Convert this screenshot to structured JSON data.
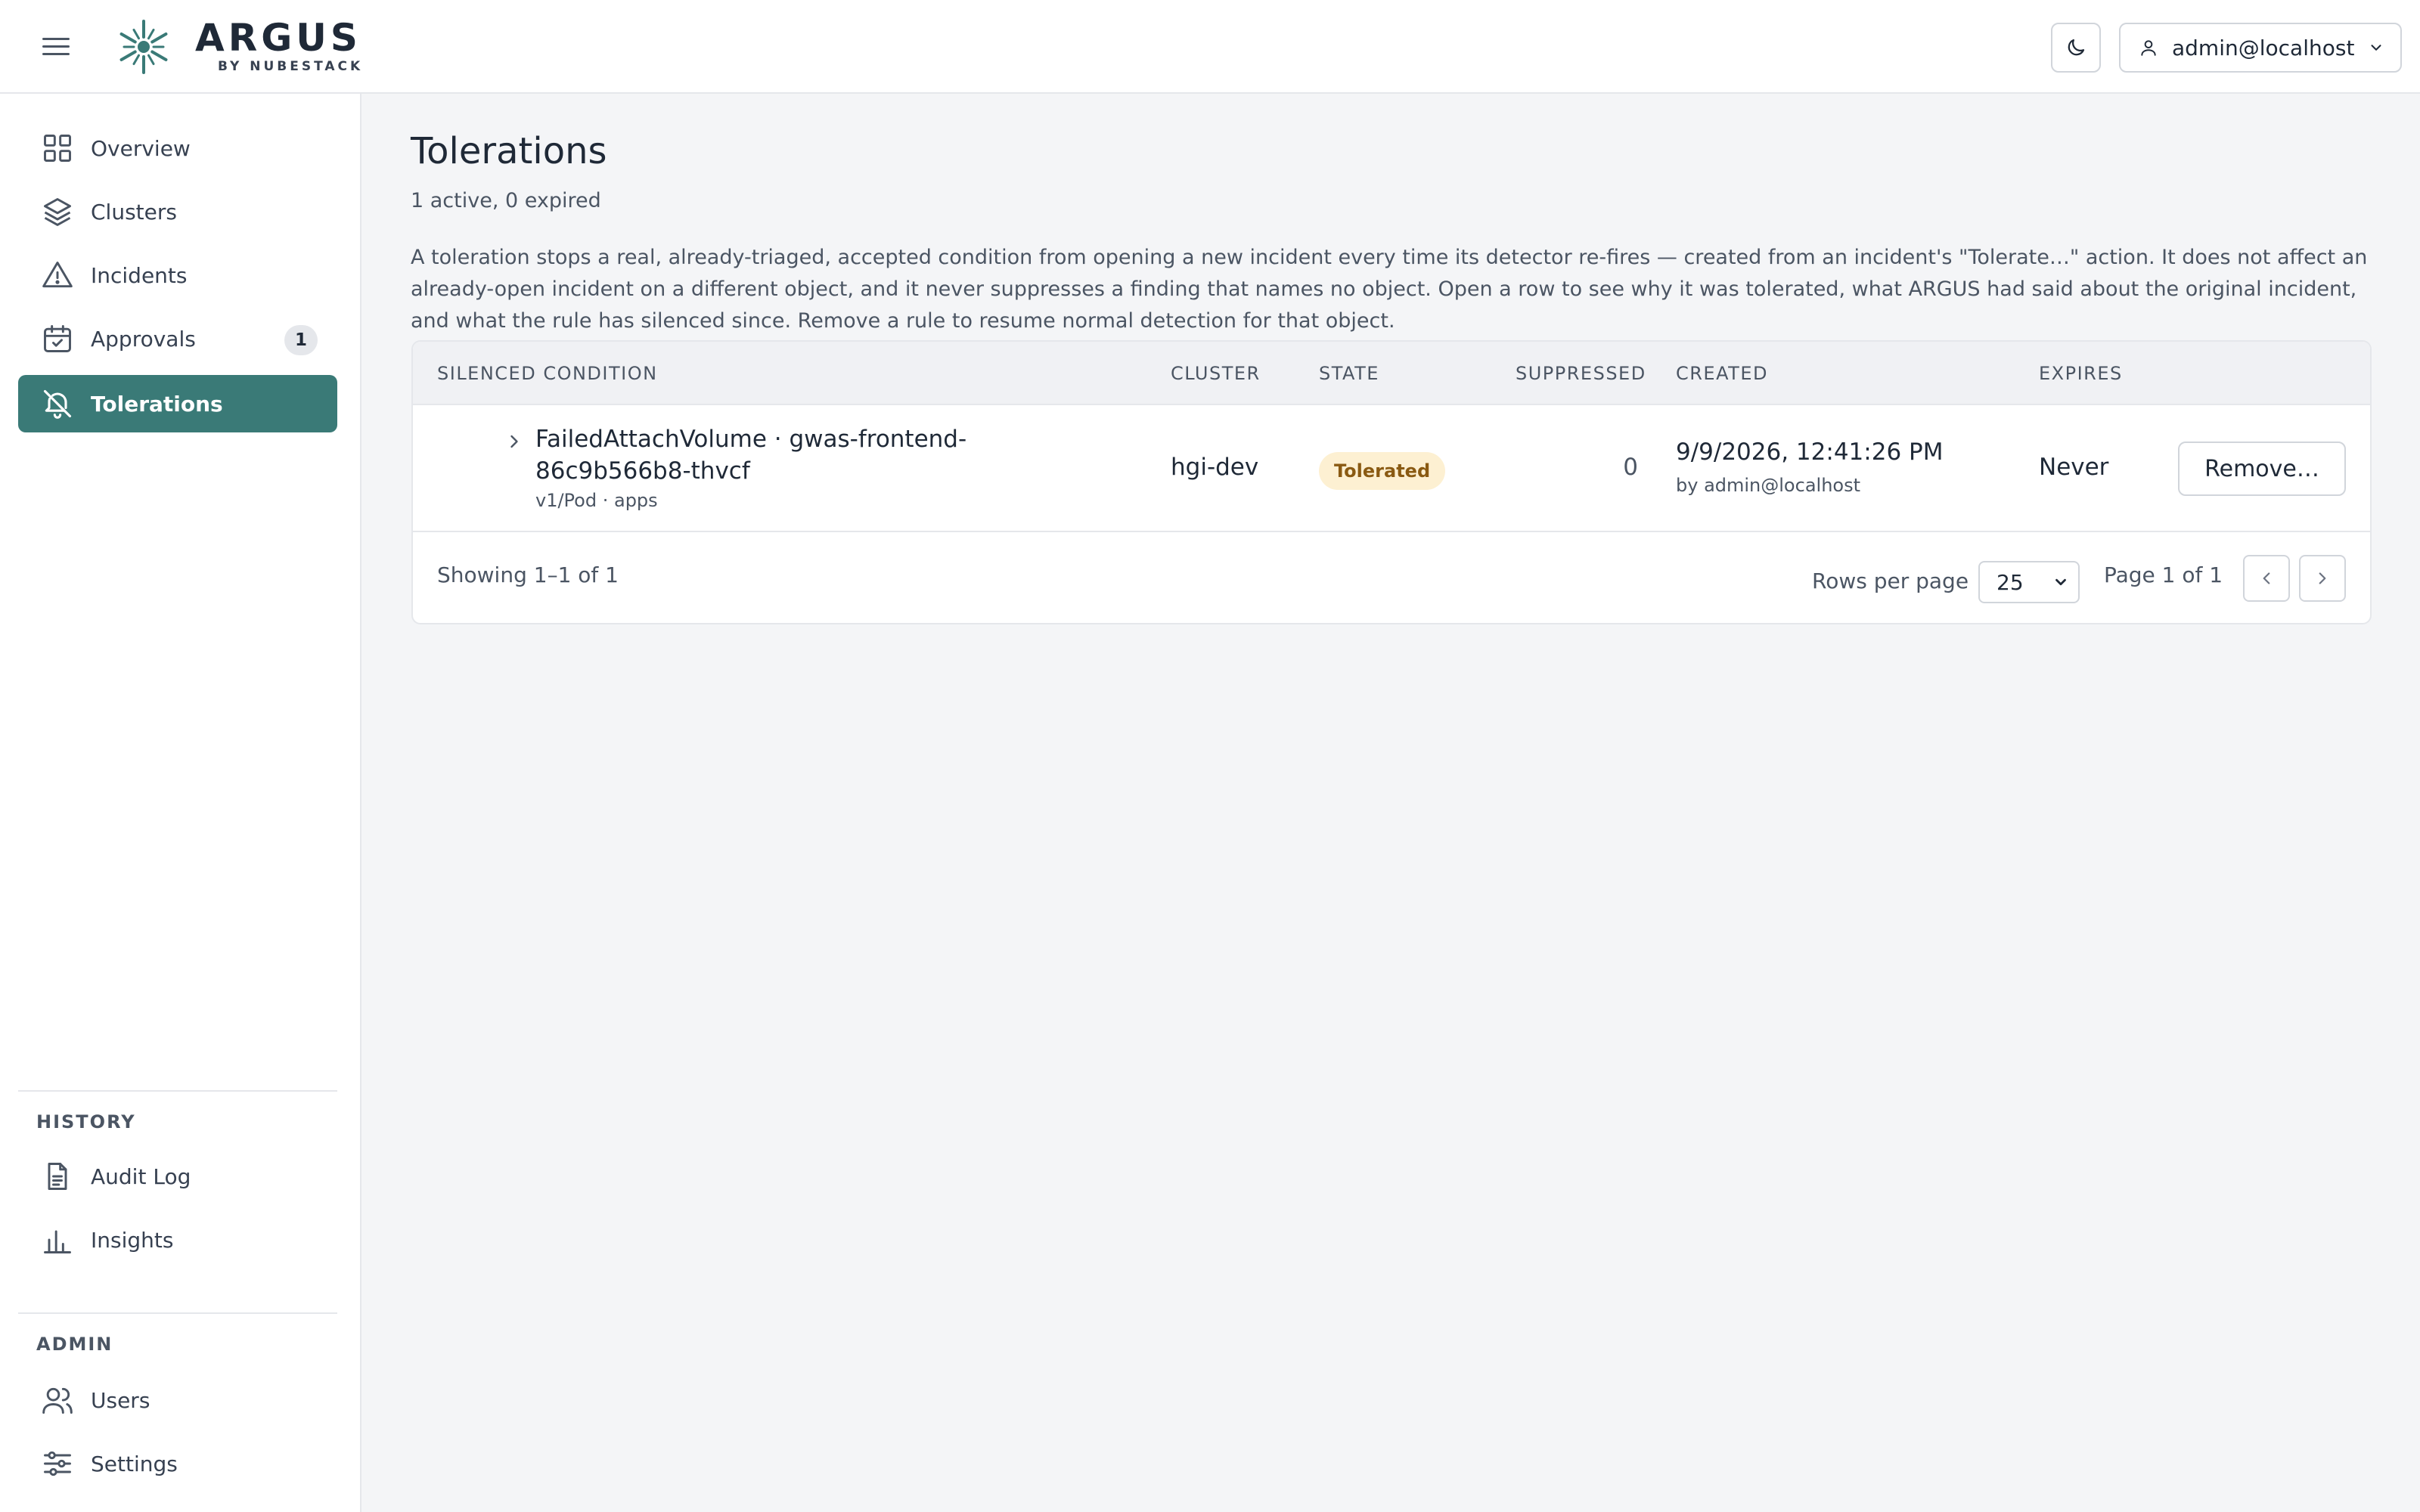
{
  "header": {
    "logo_text": "ARGUS",
    "logo_sub": "BY NUBESTACK",
    "user_label": "admin@localhost",
    "icons": {
      "menu": "hamburger-icon",
      "theme": "moon-icon",
      "user": "user-icon",
      "dropdown": "chevron-down-icon"
    }
  },
  "sidebar": {
    "items": [
      {
        "label": "Overview",
        "icon": "grid-icon"
      },
      {
        "label": "Clusters",
        "icon": "layers-icon"
      },
      {
        "label": "Incidents",
        "icon": "warning-triangle-icon"
      },
      {
        "label": "Approvals",
        "icon": "calendar-check-icon",
        "badge": "1"
      },
      {
        "label": "Tolerations",
        "icon": "bell-off-icon",
        "active": true
      }
    ],
    "history": {
      "title": "HISTORY",
      "items": [
        {
          "label": "Audit Log",
          "icon": "document-icon"
        },
        {
          "label": "Insights",
          "icon": "bar-chart-icon"
        }
      ]
    },
    "admin": {
      "title": "ADMIN",
      "items": [
        {
          "label": "Users",
          "icon": "users-icon"
        },
        {
          "label": "Settings",
          "icon": "sliders-icon"
        }
      ]
    }
  },
  "main": {
    "title": "Tolerations",
    "subtitle": "1 active, 0 expired",
    "description": "A toleration stops a real, already-triaged, accepted condition from opening a new incident every time its detector re-fires — created from an incident's \"Tolerate…\" action. It does not affect an already-open incident on a different object, and it never suppresses a finding that names no object. Open a row to see why it was tolerated, what ARGUS had said about the original incident, and what the rule has silenced since. Remove a rule to resume normal detection for that object.",
    "table": {
      "columns": [
        "SILENCED CONDITION",
        "CLUSTER",
        "STATE",
        "SUPPRESSED",
        "CREATED",
        "EXPIRES"
      ],
      "rows": [
        {
          "condition": "FailedAttachVolume · gwas-frontend-86c9b566b8-thvcf",
          "meta": "v1/Pod · apps",
          "cluster": "hgi-dev",
          "state": "Tolerated",
          "suppressed": "0",
          "created": "9/9/2026, 12:41:26 PM",
          "created_by": "by admin@localhost",
          "expires": "Never",
          "action_label": "Remove…"
        }
      ]
    },
    "footer": {
      "showing": "Showing 1–1 of 1",
      "rows_per_page_label": "Rows per page",
      "rows_per_page": "25",
      "page_info": "Page 1 of 1"
    }
  },
  "colors": {
    "accent": "#3a7a77",
    "state_badge_bg": "#fdf0d2",
    "state_badge_text": "#8a5a12"
  }
}
